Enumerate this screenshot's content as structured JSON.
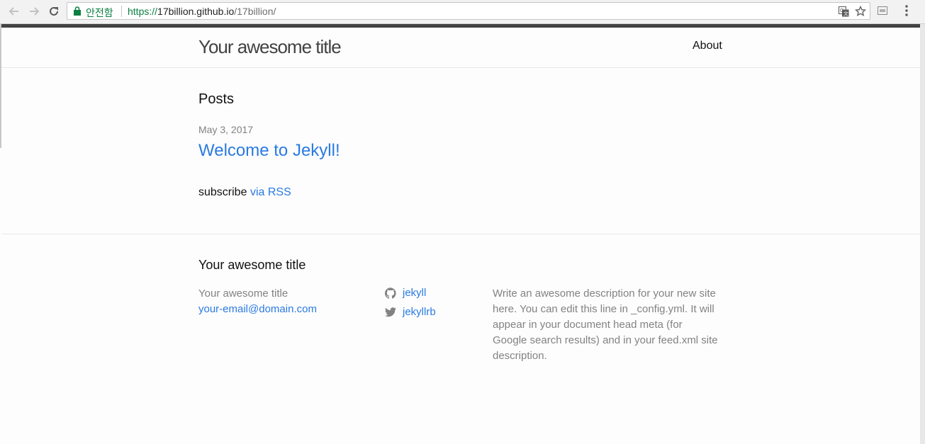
{
  "browser": {
    "secure_label": "안전함",
    "url_scheme": "https://",
    "url_host": "17billion.github.io",
    "url_path": "/17billion/"
  },
  "header": {
    "site_title": "Your awesome title",
    "nav": [
      {
        "label": "About"
      }
    ]
  },
  "main": {
    "posts_heading": "Posts",
    "posts": [
      {
        "date": "May 3, 2017",
        "title": "Welcome to Jekyll!"
      }
    ],
    "subscribe_text": "subscribe",
    "rss_link": "via RSS"
  },
  "footer": {
    "heading": "Your awesome title",
    "site_name": "Your awesome title",
    "email": "your-email@domain.com",
    "social": [
      {
        "icon": "github-icon",
        "label": "jekyll"
      },
      {
        "icon": "twitter-icon",
        "label": "jekyllrb"
      }
    ],
    "description": "Write an awesome description for your new site here. You can edit this line in _config.yml. It will appear in your document head meta (for Google search results) and in your feed.xml site description."
  },
  "colors": {
    "link": "#2a7ae2",
    "muted": "#828282",
    "accent_bar": "#424242",
    "secure": "#0b8043"
  }
}
